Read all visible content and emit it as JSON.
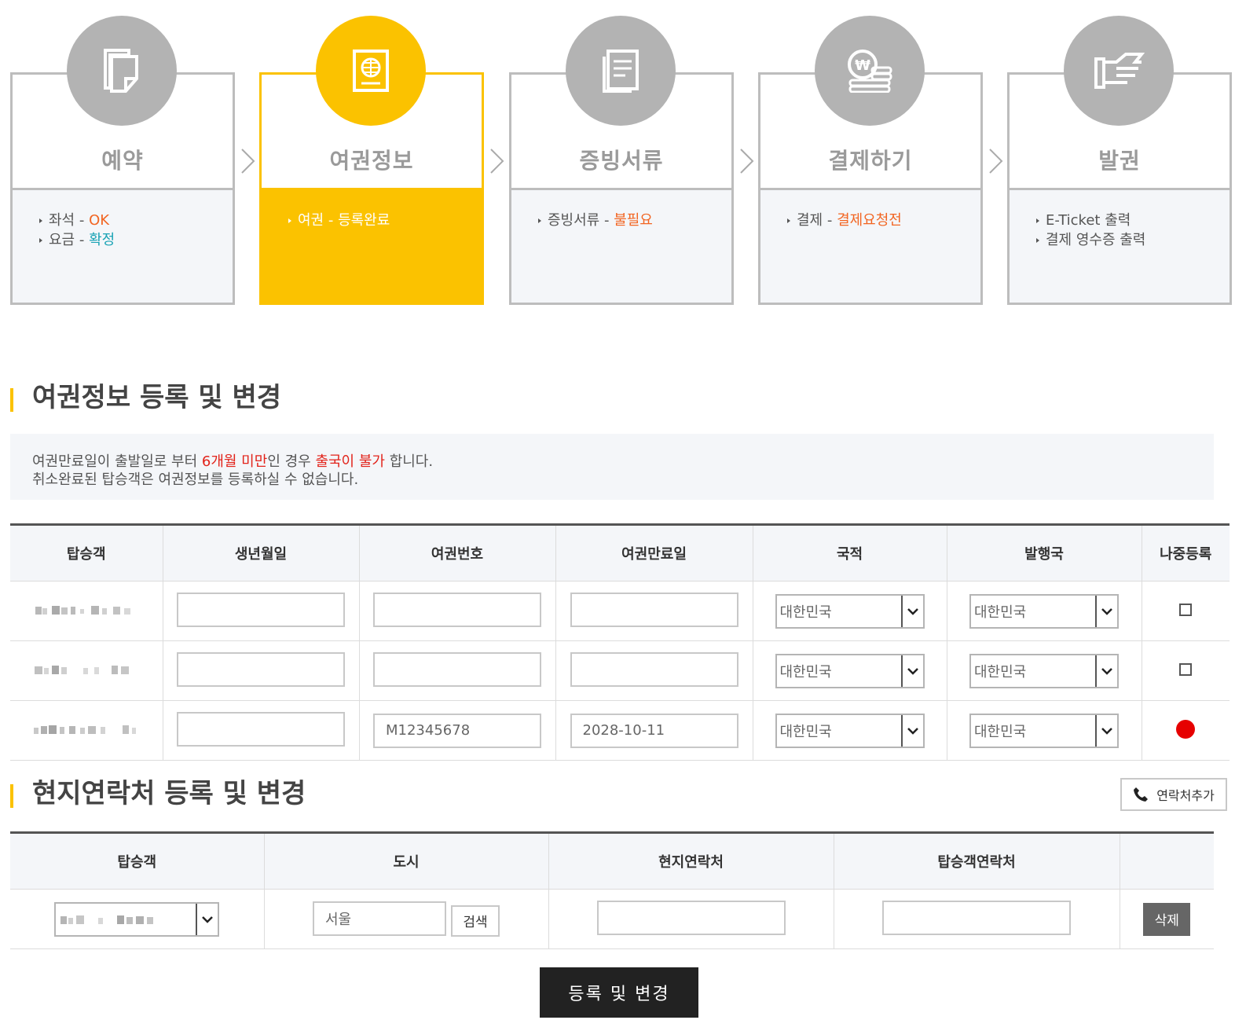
{
  "steps": [
    {
      "title": "예약",
      "lines": [
        {
          "pre": "좌석 - ",
          "hl": "OK",
          "hl_color": "orange"
        },
        {
          "pre": "요금 - ",
          "hl": "확정",
          "hl_color": "teal"
        }
      ],
      "icon": "document-icon",
      "active": false
    },
    {
      "title": "여권정보",
      "lines": [
        {
          "pre": "여권 - ",
          "hl": "등록완료",
          "hl_color": "white"
        }
      ],
      "icon": "passport-icon",
      "active": true
    },
    {
      "title": "증빙서류",
      "lines": [
        {
          "pre": "증빙서류 - ",
          "hl": "불필요",
          "hl_color": "orange"
        }
      ],
      "icon": "papers-icon",
      "active": false
    },
    {
      "title": "결제하기",
      "lines": [
        {
          "pre": "결제 - ",
          "hl": "결제요청전",
          "hl_color": "orange"
        }
      ],
      "icon": "won-coins-icon",
      "active": false
    },
    {
      "title": "발권",
      "lines": [
        {
          "pre": "E-Ticket 출력",
          "hl": "",
          "hl_color": ""
        },
        {
          "pre": "결제 영수증 출력",
          "hl": "",
          "hl_color": ""
        }
      ],
      "icon": "ticket-hand-icon",
      "active": false
    }
  ],
  "passport_section": {
    "title": "여권정보 등록 및 변경",
    "notice_line1_a": "여권만료일이 출발일로 부터 ",
    "notice_line1_red1": "6개월 미만",
    "notice_line1_b": "인 경우 ",
    "notice_line1_red2": "출국이 불가",
    "notice_line1_c": " 합니다.",
    "notice_line2": "취소완료된 탑승객은 여권정보를 등록하실 수 없습니다.",
    "headers": [
      "탑승객",
      "생년월일",
      "여권번호",
      "여권만료일",
      "국적",
      "발행국",
      "나중등록"
    ],
    "rows": [
      {
        "birth": "",
        "passport_no": "",
        "expiry": "",
        "nationality": "대한민국",
        "issuer": "대한민국",
        "later": "checkbox"
      },
      {
        "birth": "",
        "passport_no": "",
        "expiry": "",
        "nationality": "대한민국",
        "issuer": "대한민국",
        "later": "checkbox"
      },
      {
        "birth": "",
        "passport_no": "M12345678",
        "expiry": "2028-10-11",
        "nationality": "대한민국",
        "issuer": "대한민국",
        "later": "registered-dot"
      }
    ]
  },
  "contact_section": {
    "title": "현지연락처 등록 및 변경",
    "add_button": "연락처추가",
    "headers": [
      "탑승객",
      "도시",
      "현지연락처",
      "탑승객연락처",
      ""
    ],
    "row": {
      "city": "서울",
      "search_button": "검색",
      "local_contact": "",
      "passenger_contact": "",
      "delete_button": "삭제"
    }
  },
  "submit_button": "등록 및 변경",
  "colors": {
    "accent": "#fbc200",
    "inactive": "#b3b3b3",
    "orange": "#f26522",
    "teal": "#1aa3b5",
    "red": "#e2231a"
  }
}
